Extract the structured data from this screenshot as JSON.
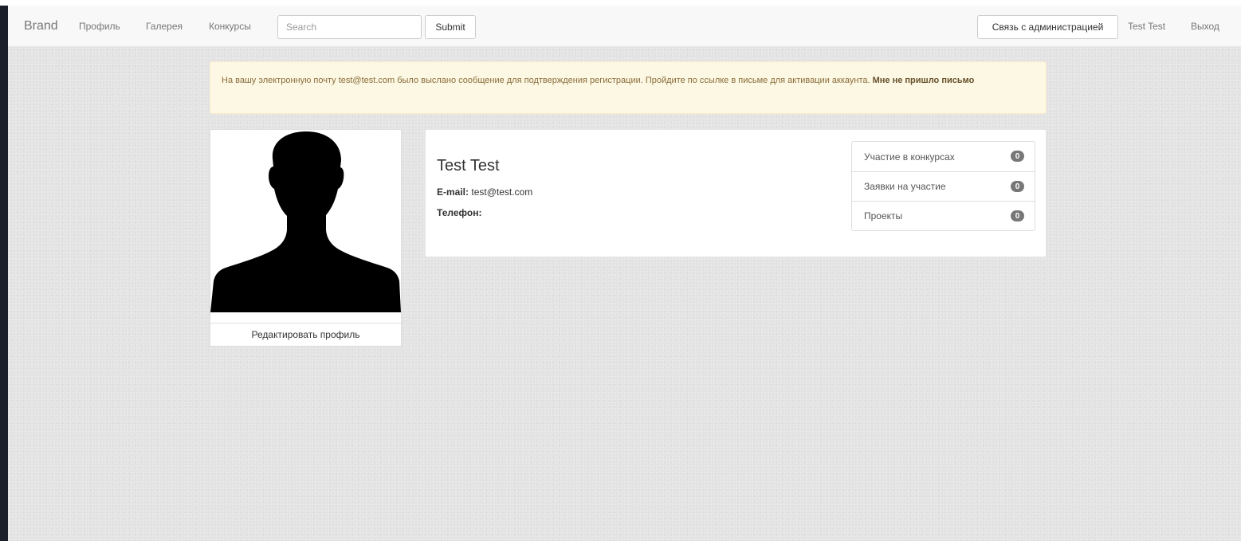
{
  "navbar": {
    "brand": "Brand",
    "links": [
      "Профиль",
      "Галерея",
      "Конкурсы"
    ],
    "search_placeholder": "Search",
    "submit_label": "Submit",
    "contact_admin_label": "Связь с администрацией",
    "user_name": "Test Test",
    "logout_label": "Выход"
  },
  "alert": {
    "message": "На вашу электронную почту test@test.com было выслано сообщение для подтверждения регистрации. Пройдите по ссылке в письме для активации аккаунта.",
    "link_text": "Мне не пришло письмо"
  },
  "profile": {
    "photo_icon": "user-silhouette-icon",
    "edit_label": "Редактировать профиль",
    "name": "Test Test",
    "email_label": "E-mail:",
    "email_value": "test@test.com",
    "phone_label": "Телефон:",
    "phone_value": ""
  },
  "stats": [
    {
      "label": "Участие в конкурсах",
      "count": "0"
    },
    {
      "label": "Заявки на участие",
      "count": "0"
    },
    {
      "label": "Проекты",
      "count": "0"
    }
  ],
  "colors": {
    "alert_bg": "#fcf8e3",
    "alert_text": "#8a6d3b",
    "badge_bg": "#777777",
    "page_bg": "#e3e3e3"
  }
}
